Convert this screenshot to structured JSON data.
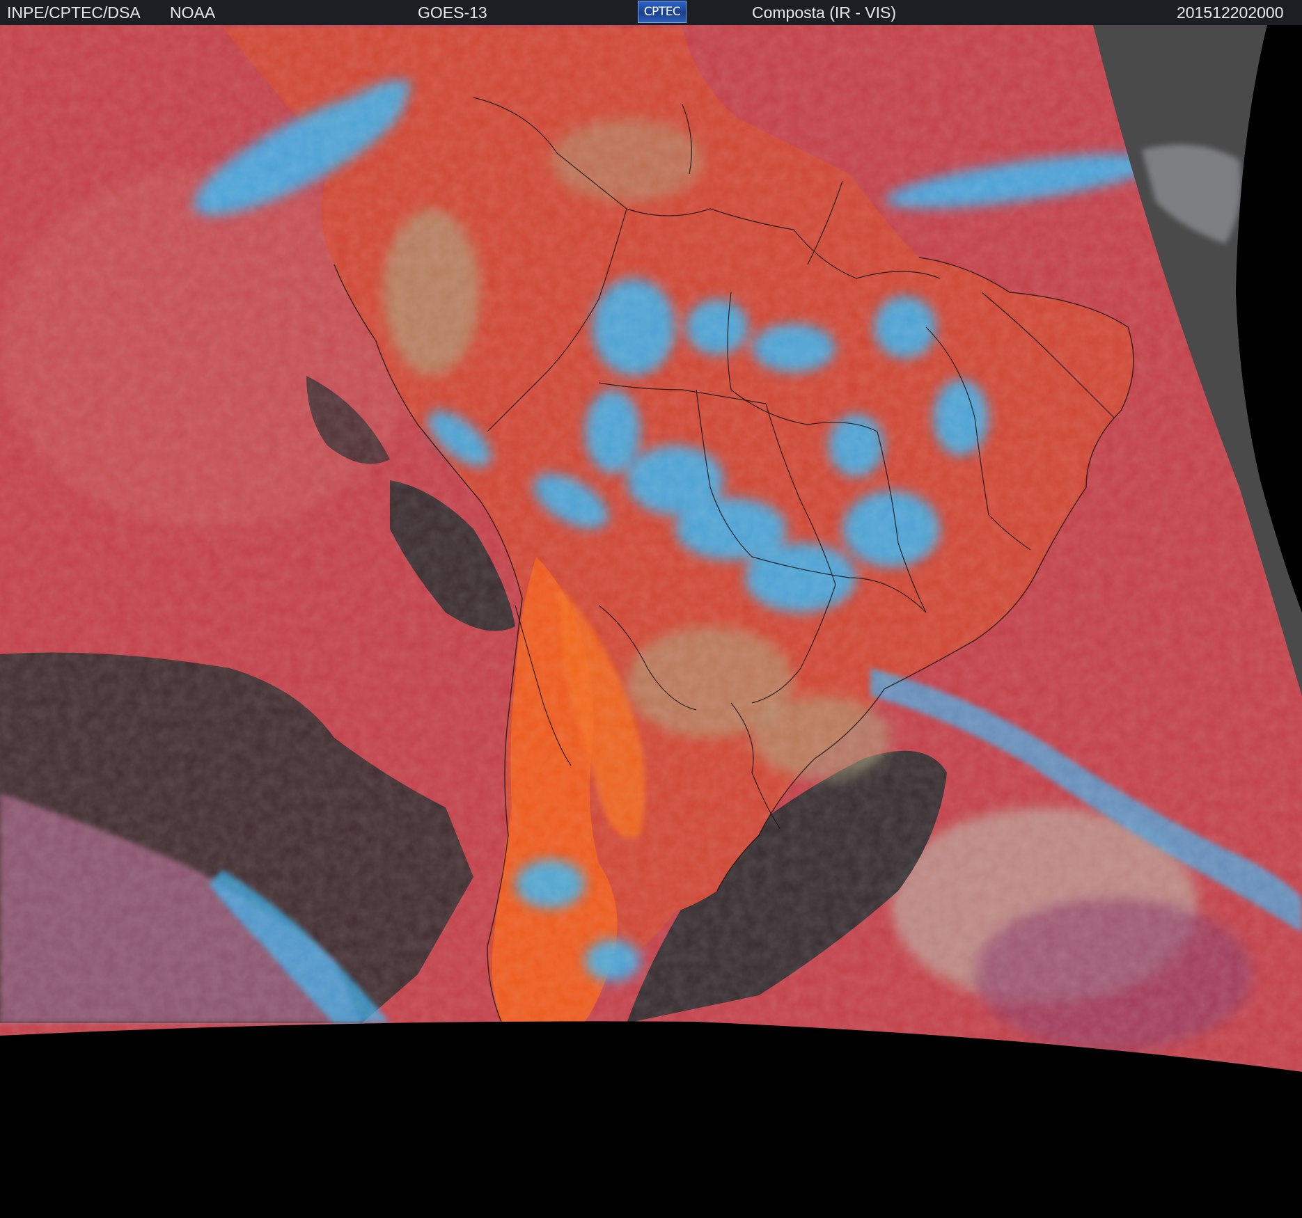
{
  "header": {
    "agency": "INPE/CPTEC/DSA",
    "partner": "NOAA",
    "satellite": "GOES-13",
    "logo_text": "CPTEC",
    "product": "Composta (IR - VIS)",
    "timestamp": "201512202000"
  },
  "colors": {
    "background": "#000000",
    "header_bar": "#1b1f24",
    "header_text": "#e8e8e8",
    "clear_ocean": "#c2414a",
    "clear_land_warm": "#e0502a",
    "high_cloud": "#37b3f0",
    "low_cloud": "#a8a878",
    "dark_gap": "#2a2a2a",
    "grey_disk_edge": "#4a4a4a",
    "borders": "#000000"
  }
}
